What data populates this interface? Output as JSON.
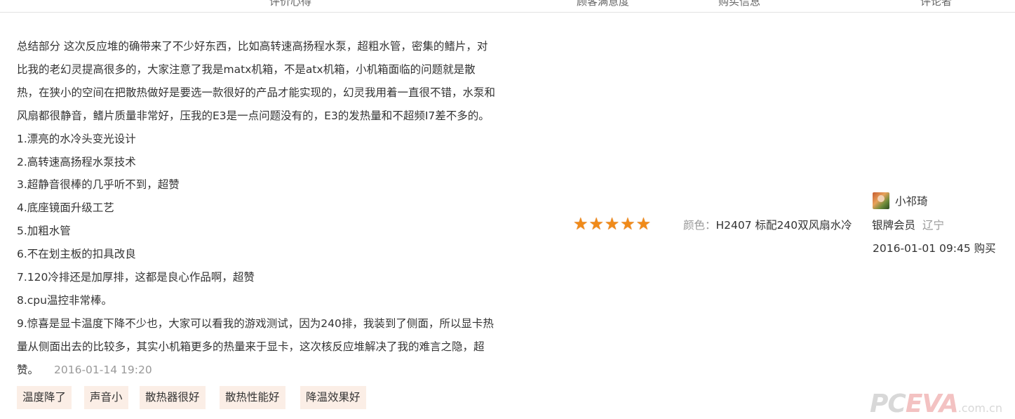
{
  "header": {
    "columns": [
      "评价心得",
      "顾客满意度",
      "购买信息",
      "评论者"
    ]
  },
  "review": {
    "lines": [
      "总结部分 这次反应堆的确带来了不少好东西，比如高转速高扬程水泵，超粗水管，密集的鳍片，对",
      "比我的老幻灵提高很多的，大家注意了我是matx机箱，不是atx机箱，小机箱面临的问题就是散",
      "热，在狭小的空间在把散热做好是要选一款很好的产品才能实现的，幻灵我用着一直很不错，水泵和",
      "风扇都很静音，鳍片质量非常好，压我的E3是一点问题没有的，E3的发热量和不超频I7差不多的。",
      "1.漂亮的水冷头变光设计",
      "2.高转速高扬程水泵技术",
      "3.超静音很棒的几乎听不到，超赞",
      "4.底座镜面升级工艺",
      "5.加粗水管",
      "6.不在划主板的扣具改良",
      "7.120冷排还是加厚排，这都是良心作品啊，超赞",
      "8.cpu温控非常棒。",
      "9.惊喜是显卡温度下降不少也，大家可以看我的游戏测试，因为240排，我装到了侧面，所以显卡热",
      "量从侧面出去的比较多，其实小机箱更多的热量来于显卡，这次核反应堆解决了我的难言之隐，超"
    ],
    "last_line": "赞。",
    "date": "2016-01-14 19:20",
    "tags": [
      "温度降了",
      "声音小",
      "散热器很好",
      "散热性能好",
      "降温效果好"
    ]
  },
  "rating": {
    "stars": 5,
    "max": 5,
    "star_color": "#f08a19"
  },
  "purchase": {
    "color_label": "颜色：",
    "color_value": "H2407 标配240双风扇水冷"
  },
  "reviewer": {
    "name": "小祁琦",
    "avatar_icon": "user-avatar-icon",
    "level": "银牌会员",
    "region": "辽宁",
    "buy_time": "2016-01-01 09:45 购买"
  },
  "watermark": {
    "pc": "PC",
    "eva": "EVA",
    "domain": ".com.cn"
  }
}
